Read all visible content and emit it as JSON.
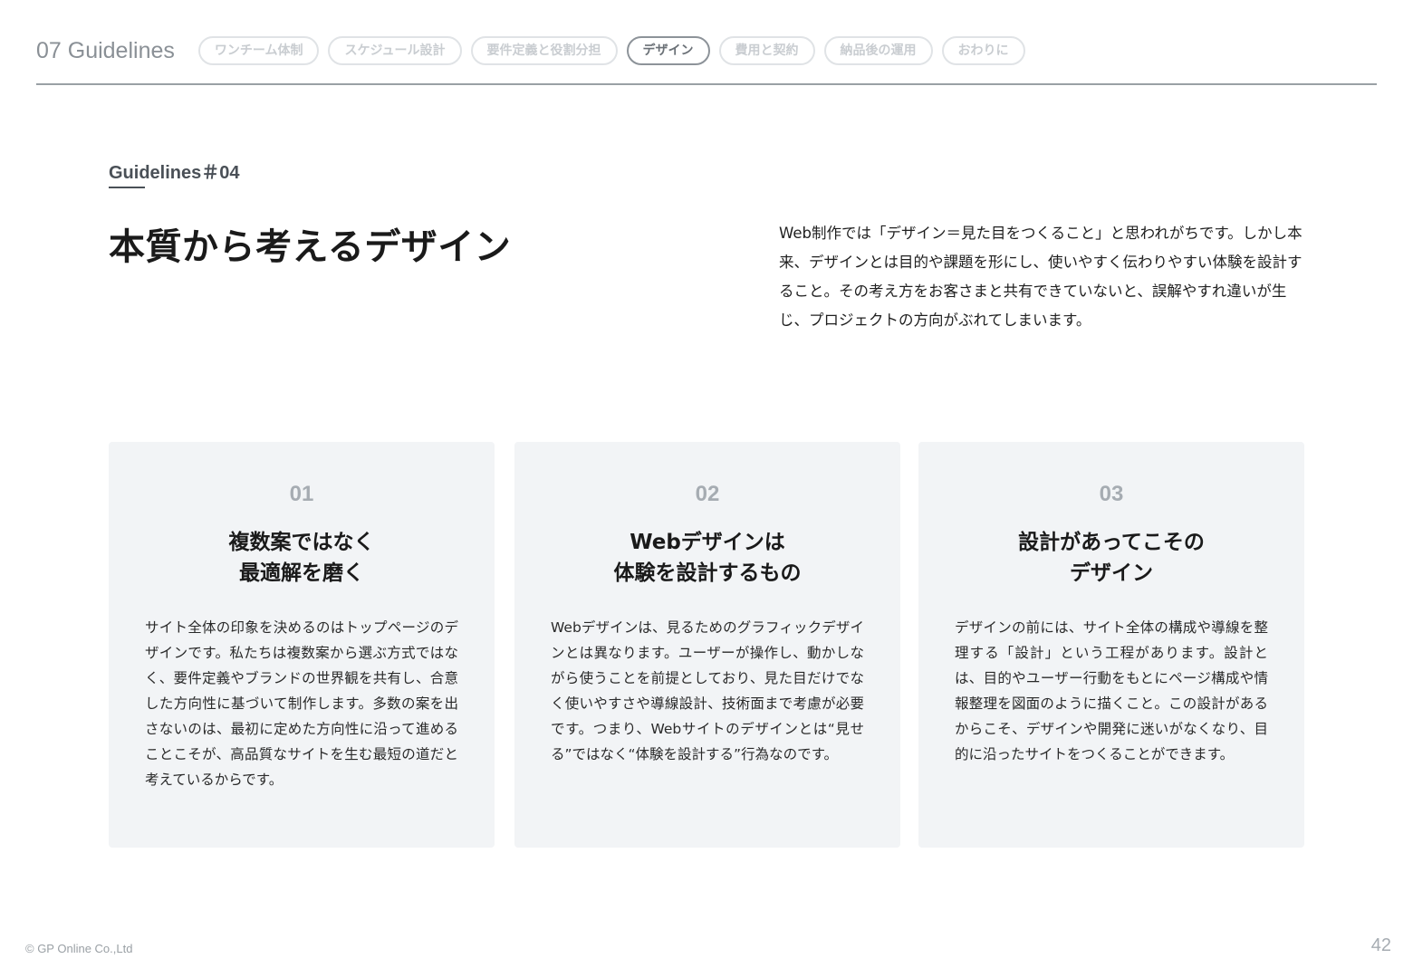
{
  "header": {
    "section_title": "07 Guidelines",
    "tabs": [
      {
        "label": "ワンチーム体制",
        "active": false
      },
      {
        "label": "スケジュール設計",
        "active": false
      },
      {
        "label": "要件定義と役割分担",
        "active": false
      },
      {
        "label": "デザイン",
        "active": true
      },
      {
        "label": "費用と契約",
        "active": false
      },
      {
        "label": "納品後の運用",
        "active": false
      },
      {
        "label": "おわりに",
        "active": false
      }
    ]
  },
  "intro": {
    "label": "Guidelines＃04",
    "title": "本質から考えるデザイン",
    "description": "Web制作では「デザイン＝見た目をつくること」と思われがちです。しかし本来、デザインとは目的や課題を形にし、使いやすく伝わりやすい体験を設計すること。その考え方をお客さまと共有できていないと、誤解やすれ違いが生じ、プロジェクトの方向がぶれてしまいます。"
  },
  "cards": [
    {
      "number": "01",
      "heading_line1": "複数案ではなく",
      "heading_line2": "最適解を磨く",
      "body": "サイト全体の印象を決めるのはトップページのデザインです。私たちは複数案から選ぶ方式ではなく、要件定義やブランドの世界観を共有し、合意した方向性に基づいて制作します。多数の案を出さないのは、最初に定めた方向性に沿って進めることこそが、高品質なサイトを生む最短の道だと考えているからです。"
    },
    {
      "number": "02",
      "heading_line1": "Webデザインは",
      "heading_line2": "体験を設計するもの",
      "body": "Webデザインは、見るためのグラフィックデザインとは異なります。ユーザーが操作し、動かしながら使うことを前提としており、見た目だけでなく使いやすさや導線設計、技術面まで考慮が必要です。つまり、Webサイトのデザインとは“見せる”ではなく“体験を設計する”行為なのです。"
    },
    {
      "number": "03",
      "heading_line1": "設計があってこその",
      "heading_line2": "デザイン",
      "body": "デザインの前には、サイト全体の構成や導線を整理する「設計」という工程があります。設計とは、目的やユーザー行動をもとにページ構成や情報整理を図面のように描くこと。この設計があるからこそ、デザインや開発に迷いがなくなり、目的に沿ったサイトをつくることができます。"
    }
  ],
  "footer": {
    "copyright": "© GP Online Co.,Ltd",
    "page_number": "42"
  }
}
